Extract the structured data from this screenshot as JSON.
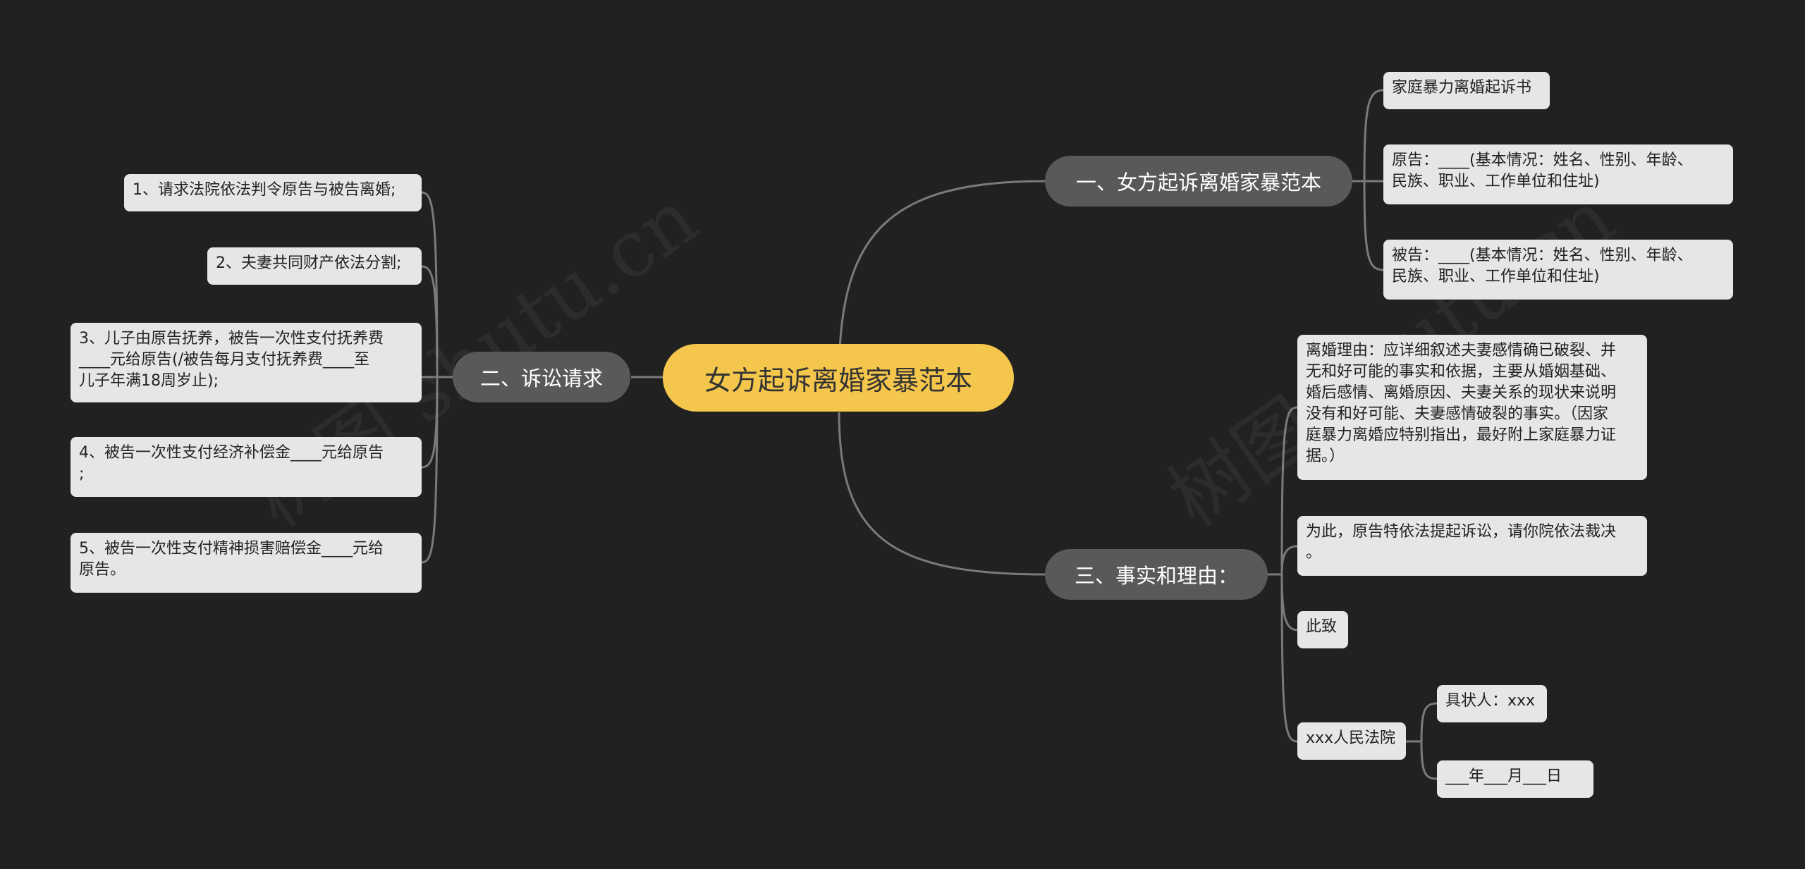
{
  "root": {
    "label": "女方起诉离婚家暴范本"
  },
  "branches": {
    "b1": {
      "label": "一、女方起诉离婚家暴范本",
      "children": [
        "家庭暴力离婚起诉书",
        "原告：____(基本情况：姓名、性别、年龄、\n民族、职业、工作单位和住址)",
        "被告：____(基本情况：姓名、性别、年龄、\n民族、职业、工作单位和住址)"
      ]
    },
    "b2": {
      "label": "二、诉讼请求",
      "children": [
        "1、请求法院依法判令原告与被告离婚;",
        "2、夫妻共同财产依法分割;",
        "3、儿子由原告抚养，被告一次性支付抚养费\n____元给原告(/被告每月支付抚养费____至\n儿子年满18周岁止);",
        "4、被告一次性支付经济补偿金____元给原告\n;",
        "5、被告一次性支付精神损害赔偿金____元给\n原告。"
      ]
    },
    "b3": {
      "label": "三、事实和理由：",
      "children": [
        "离婚理由：应详细叙述夫妻感情确已破裂、并\n无和好可能的事实和依据，主要从婚姻基础、\n婚后感情、离婚原因、夫妻关系的现状来说明\n没有和好可能、夫妻感情破裂的事实。（因家\n庭暴力离婚应特别指出，最好附上家庭暴力证\n据。）",
        "为此，原告特依法提起诉讼，请你院依法裁决\n。",
        "此致",
        "xxx人民法院"
      ],
      "court_children": [
        "具状人：xxx",
        "___年___月___日"
      ]
    }
  },
  "watermark": "树图 shutu.cn",
  "colors": {
    "background": "#212121",
    "root": "#f5c64c",
    "branch": "#5b5958",
    "leaf": "#e6e6e6",
    "line": "#7a7a7a"
  }
}
